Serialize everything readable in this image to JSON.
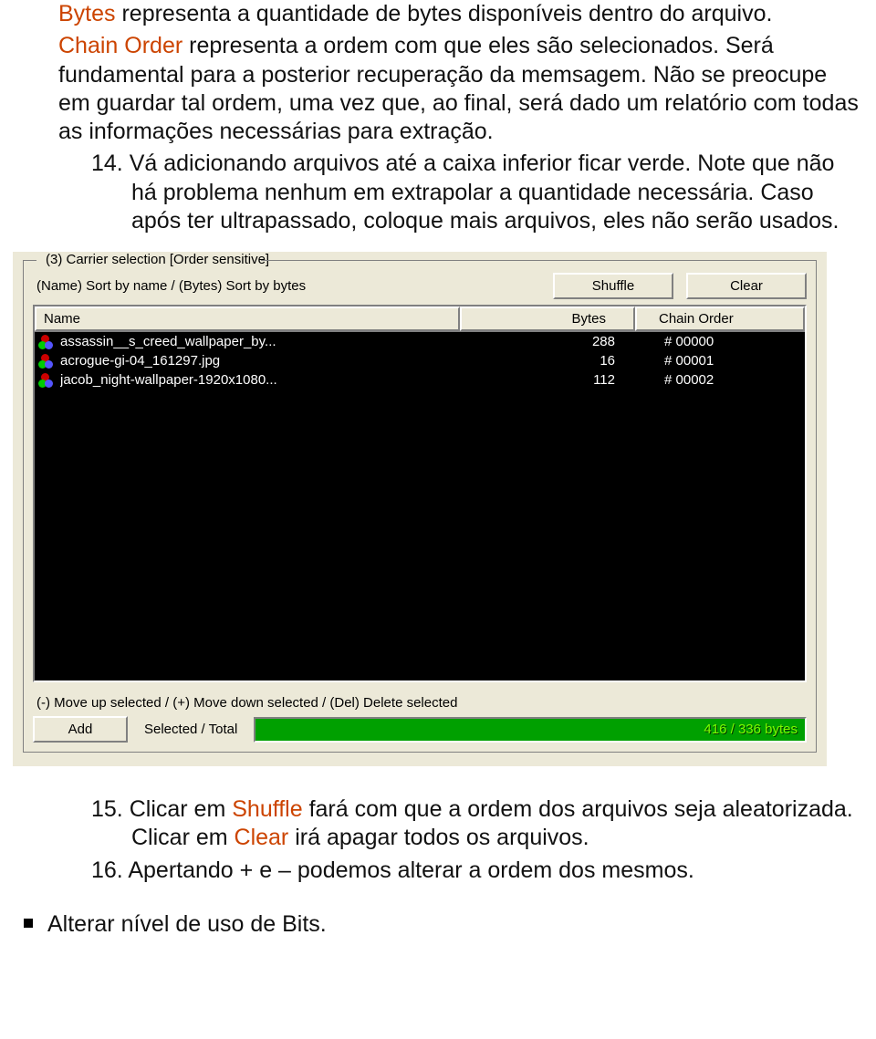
{
  "doc": {
    "p1a": "Bytes",
    "p1b": " representa a quantidade de bytes disponíveis dentro do arquivo.",
    "p2a": "Chain Order",
    "p2b": " representa a ordem com que eles são selecionados. Será fundamental para a posterior recuperação da memsagem. Não se preocupe em guardar tal ordem, uma vez que, ao final, será dado um relatório com todas as informações necessárias para extração.",
    "item14_num": "14.",
    "item14_body": " Vá adicionando arquivos até a caixa inferior ficar verde. Note que não há problema nenhum em extrapolar a quantidade necessária. Caso após ter ultrapassado, coloque mais arquivos, eles não serão usados.",
    "item15_num": "15.",
    "item15_a": " Clicar em ",
    "item15_shuffle": "Shuffle",
    "item15_b": " fará com que a ordem dos arquivos seja aleatorizada. Clicar em ",
    "item15_clear": "Clear",
    "item15_c": " irá apagar todos os arquivos.",
    "item16_num": "16.",
    "item16_body": " Apertando + e – podemos alterar a ordem dos mesmos.",
    "bullet": "Alterar nível de uso de Bits."
  },
  "ui": {
    "group_title": "(3)  Carrier selection [Order sensitive]",
    "sort_hint": "(Name) Sort by name / (Bytes) Sort by bytes",
    "shuffle": "Shuffle",
    "clear": "Clear",
    "col_name": "Name",
    "col_bytes": "Bytes",
    "col_order": "Chain Order",
    "rows": [
      {
        "name": "assassin__s_creed_wallpaper_by...",
        "bytes": "288",
        "order": "# 00000"
      },
      {
        "name": "acrogue-gi-04_161297.jpg",
        "bytes": "16",
        "order": "# 00001"
      },
      {
        "name": "jacob_night-wallpaper-1920x1080...",
        "bytes": "112",
        "order": "# 00002"
      }
    ],
    "move_hint": "(-) Move up selected / (+) Move down selected / (Del) Delete selected",
    "add": "Add",
    "seltot_label": "Selected / Total",
    "seltot_value": "416 / 336 bytes"
  }
}
